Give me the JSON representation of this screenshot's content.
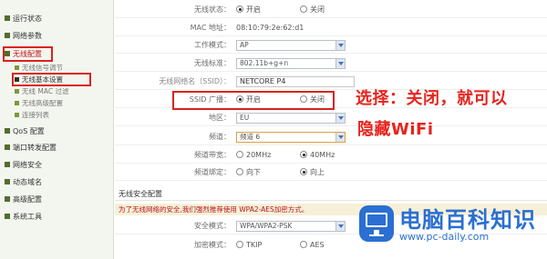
{
  "sidebar": {
    "items": [
      {
        "label": "运行状态"
      },
      {
        "label": "网络参数"
      },
      {
        "label": "无线配置"
      },
      {
        "label": "QoS 配置"
      },
      {
        "label": "端口转发配置"
      },
      {
        "label": "网络安全"
      },
      {
        "label": "动态域名"
      },
      {
        "label": "高级配置"
      },
      {
        "label": "系统工具"
      }
    ],
    "subitems": [
      {
        "label": "无线信号调节"
      },
      {
        "label": "无线基本设置"
      },
      {
        "label": "无线 MAC 过滤"
      },
      {
        "label": "无线高级配置"
      },
      {
        "label": "连接列表"
      }
    ]
  },
  "basic": {
    "wireless_status": {
      "label": "无线状态：",
      "opt_on": "开启",
      "opt_off": "关闭"
    },
    "mac": {
      "label": "MAC 地址：",
      "value": "08:10:79:2e:62:d1"
    },
    "mode": {
      "label": "工作模式：",
      "value": "AP"
    },
    "standard": {
      "label": "无线标准：",
      "value": "802.11b+g+n"
    },
    "ssid": {
      "label": "无线网络名（SSID）：",
      "value": "NETCORE P4"
    },
    "ssid_broadcast": {
      "label": "SSID 广播：",
      "opt_on": "开启",
      "opt_off": "关闭"
    },
    "region": {
      "label": "地区：",
      "value": "EU"
    },
    "channel": {
      "label": "频道：",
      "value": "频道 6"
    },
    "bandwidth": {
      "label": "频道带宽：",
      "opt_a": "20MHz",
      "opt_b": "40MHz"
    },
    "sideband": {
      "label": "频道绑定：",
      "opt_a": "向下",
      "opt_b": "向上"
    }
  },
  "security": {
    "heading": "无线安全配置",
    "note": "为了无线网络的安全,我们强烈推荐使用 WPA2-AES加密方式。",
    "mode": {
      "label": "安全模式：",
      "value": "WPA/WPA2-PSK"
    },
    "encryption": {
      "label": "加密模式：",
      "opt_a": "TKIP",
      "opt_b": "AES"
    }
  },
  "annotation": {
    "line1": "选择：关闭，就可以",
    "line2": "隐藏WiFi"
  },
  "logo": {
    "brand": "电脑百科知识",
    "site": "www.pc-daily.com"
  }
}
